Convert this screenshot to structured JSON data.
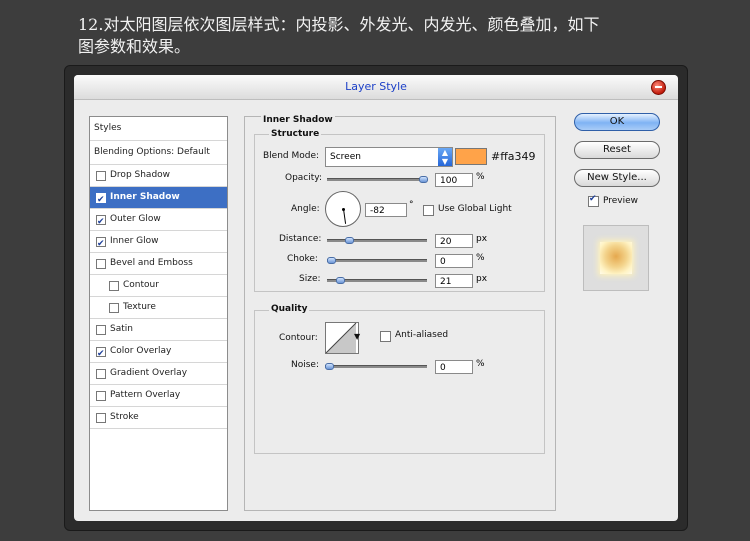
{
  "caption": {
    "line1": "12.对太阳图层依次图层样式：内投影、外发光、内发光、颜色叠加，如下",
    "line2": "图参数和效果。"
  },
  "dialog": {
    "title": "Layer Style"
  },
  "styles_panel": {
    "header": "Styles",
    "blending": "Blending Options: Default",
    "items": [
      {
        "label": "Drop Shadow",
        "checked": false,
        "selected": false,
        "indent": false
      },
      {
        "label": "Inner Shadow",
        "checked": true,
        "selected": true,
        "indent": false
      },
      {
        "label": "Outer Glow",
        "checked": true,
        "selected": false,
        "indent": false
      },
      {
        "label": "Inner Glow",
        "checked": true,
        "selected": false,
        "indent": false
      },
      {
        "label": "Bevel and Emboss",
        "checked": false,
        "selected": false,
        "indent": false
      },
      {
        "label": "Contour",
        "checked": false,
        "selected": false,
        "indent": true
      },
      {
        "label": "Texture",
        "checked": false,
        "selected": false,
        "indent": true
      },
      {
        "label": "Satin",
        "checked": false,
        "selected": false,
        "indent": false
      },
      {
        "label": "Color Overlay",
        "checked": true,
        "selected": false,
        "indent": false
      },
      {
        "label": "Gradient Overlay",
        "checked": false,
        "selected": false,
        "indent": false
      },
      {
        "label": "Pattern Overlay",
        "checked": false,
        "selected": false,
        "indent": false
      },
      {
        "label": "Stroke",
        "checked": false,
        "selected": false,
        "indent": false
      }
    ]
  },
  "inner_shadow": {
    "section_title": "Inner Shadow",
    "structure_title": "Structure",
    "blend_mode_label": "Blend Mode:",
    "blend_mode_value": "Screen",
    "color": "#ffa349",
    "color_text": "#ffa349",
    "opacity_label": "Opacity:",
    "opacity_value": "100",
    "opacity_level": 1.0,
    "percent": "%",
    "angle_label": "Angle:",
    "angle_value": "-82",
    "angle_unit": "°",
    "global_light_label": "Use Global Light",
    "distance_label": "Distance:",
    "distance_value": "20",
    "distance_level": 0.2,
    "choke_label": "Choke:",
    "choke_value": "0",
    "choke_level": 0.0,
    "size_label": "Size:",
    "size_value": "21",
    "size_level": 0.1,
    "px": "px",
    "quality_title": "Quality",
    "contour_label": "Contour:",
    "anti_aliased_label": "Anti-aliased",
    "noise_label": "Noise:",
    "noise_value": "0",
    "noise_level": 0.0
  },
  "buttons": {
    "ok": "OK",
    "reset": "Reset",
    "new_style": "New Style...",
    "preview_label": "Preview"
  }
}
